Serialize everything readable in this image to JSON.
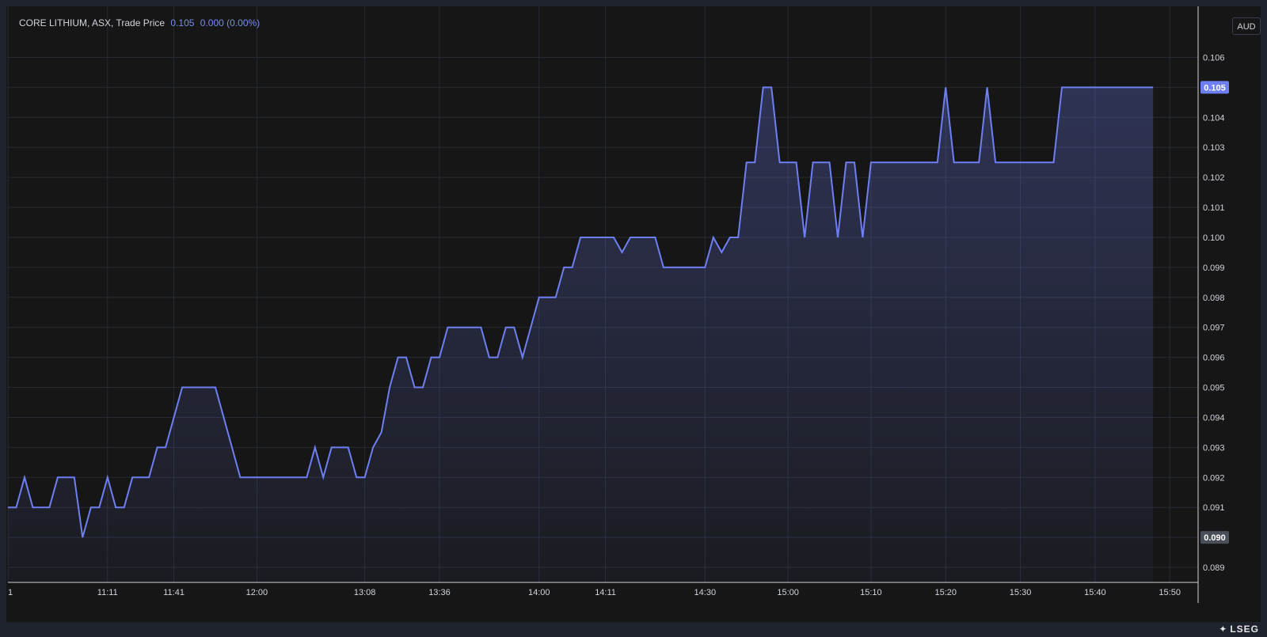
{
  "legend": {
    "instrument": "CORE LITHIUM, ASX, Trade Price",
    "last_price": "0.105",
    "change": "0.000 (0.00%)"
  },
  "currency_button": "AUD",
  "brand": "LSEG",
  "colors": {
    "background": "#161616",
    "line": "#6e7ff3",
    "fill": "#6e7ff3",
    "grid": "#262a33",
    "last_price_tag": "#6e7ff3",
    "low_tag": "#4a4e58"
  },
  "chart_data": {
    "type": "area",
    "ylim": [
      0.0885,
      0.1077
    ],
    "y_ticks": [
      0.089,
      0.09,
      0.091,
      0.092,
      0.093,
      0.094,
      0.095,
      0.096,
      0.097,
      0.098,
      0.099,
      0.1,
      0.101,
      0.102,
      0.103,
      0.104,
      0.105,
      0.106
    ],
    "y_tick_labels": [
      "0.089",
      "0.090",
      "0.091",
      "0.092",
      "0.093",
      "0.094",
      "0.095",
      "0.096",
      "0.097",
      "0.098",
      "0.099",
      "0.100",
      "0.101",
      "0.102",
      "0.103",
      "0.104",
      "0.105",
      "0.106"
    ],
    "x_ticks": [
      {
        "i": 0,
        "label": "1"
      },
      {
        "i": 12,
        "label": "11:11"
      },
      {
        "i": 20,
        "label": "11:41"
      },
      {
        "i": 30,
        "label": "12:00"
      },
      {
        "i": 43,
        "label": "13:08"
      },
      {
        "i": 52,
        "label": "13:36"
      },
      {
        "i": 64,
        "label": "14:00"
      },
      {
        "i": 72,
        "label": "14:11"
      },
      {
        "i": 84,
        "label": "14:30"
      },
      {
        "i": 94,
        "label": "15:00"
      },
      {
        "i": 104,
        "label": "15:10"
      },
      {
        "i": 113,
        "label": "15:20"
      },
      {
        "i": 122,
        "label": "15:30"
      },
      {
        "i": 131,
        "label": "15:40"
      },
      {
        "i": 140,
        "label": "15:50"
      }
    ],
    "x_count": 141,
    "last_price_label": "0.105",
    "last_price_value": 0.105,
    "low_label": "0.090",
    "low_value": 0.09,
    "grid": true,
    "series": [
      {
        "points": [
          [
            0,
            0.091
          ],
          [
            1,
            0.091
          ],
          [
            2,
            0.092
          ],
          [
            3,
            0.091
          ],
          [
            5,
            0.091
          ],
          [
            6,
            0.092
          ],
          [
            8,
            0.092
          ],
          [
            9,
            0.09
          ],
          [
            10,
            0.091
          ],
          [
            11,
            0.091
          ],
          [
            12,
            0.092
          ],
          [
            13,
            0.091
          ],
          [
            14,
            0.091
          ],
          [
            15,
            0.092
          ],
          [
            17,
            0.092
          ],
          [
            18,
            0.093
          ],
          [
            19,
            0.093
          ],
          [
            21,
            0.095
          ],
          [
            25,
            0.095
          ],
          [
            28,
            0.092
          ],
          [
            36,
            0.092
          ],
          [
            37,
            0.093
          ],
          [
            38,
            0.092
          ],
          [
            39,
            0.093
          ],
          [
            41,
            0.093
          ],
          [
            42,
            0.092
          ],
          [
            43,
            0.092
          ],
          [
            44,
            0.093
          ],
          [
            45,
            0.0935
          ],
          [
            46,
            0.095
          ],
          [
            47,
            0.096
          ],
          [
            48,
            0.096
          ],
          [
            49,
            0.095
          ],
          [
            50,
            0.095
          ],
          [
            51,
            0.096
          ],
          [
            52,
            0.096
          ],
          [
            53,
            0.097
          ],
          [
            57,
            0.097
          ],
          [
            58,
            0.096
          ],
          [
            59,
            0.096
          ],
          [
            60,
            0.097
          ],
          [
            61,
            0.097
          ],
          [
            62,
            0.096
          ],
          [
            64,
            0.098
          ],
          [
            66,
            0.098
          ],
          [
            67,
            0.099
          ],
          [
            68,
            0.099
          ],
          [
            69,
            0.1
          ],
          [
            73,
            0.1
          ],
          [
            74,
            0.0995
          ],
          [
            75,
            0.1
          ],
          [
            78,
            0.1
          ],
          [
            79,
            0.099
          ],
          [
            84,
            0.099
          ],
          [
            85,
            0.1
          ],
          [
            86,
            0.0995
          ],
          [
            87,
            0.1
          ],
          [
            88,
            0.1
          ],
          [
            89,
            0.1025
          ],
          [
            90,
            0.1025
          ],
          [
            91,
            0.105
          ],
          [
            92,
            0.105
          ],
          [
            93,
            0.1025
          ],
          [
            95,
            0.1025
          ],
          [
            96,
            0.1
          ],
          [
            97,
            0.1025
          ],
          [
            99,
            0.1025
          ],
          [
            100,
            0.1
          ],
          [
            101,
            0.1025
          ],
          [
            102,
            0.1025
          ],
          [
            103,
            0.1
          ],
          [
            104,
            0.1025
          ],
          [
            112,
            0.1025
          ],
          [
            113,
            0.105
          ],
          [
            114,
            0.1025
          ],
          [
            117,
            0.1025
          ],
          [
            118,
            0.105
          ],
          [
            119,
            0.1025
          ],
          [
            126,
            0.1025
          ],
          [
            127,
            0.105
          ],
          [
            138,
            0.105
          ]
        ]
      }
    ]
  }
}
